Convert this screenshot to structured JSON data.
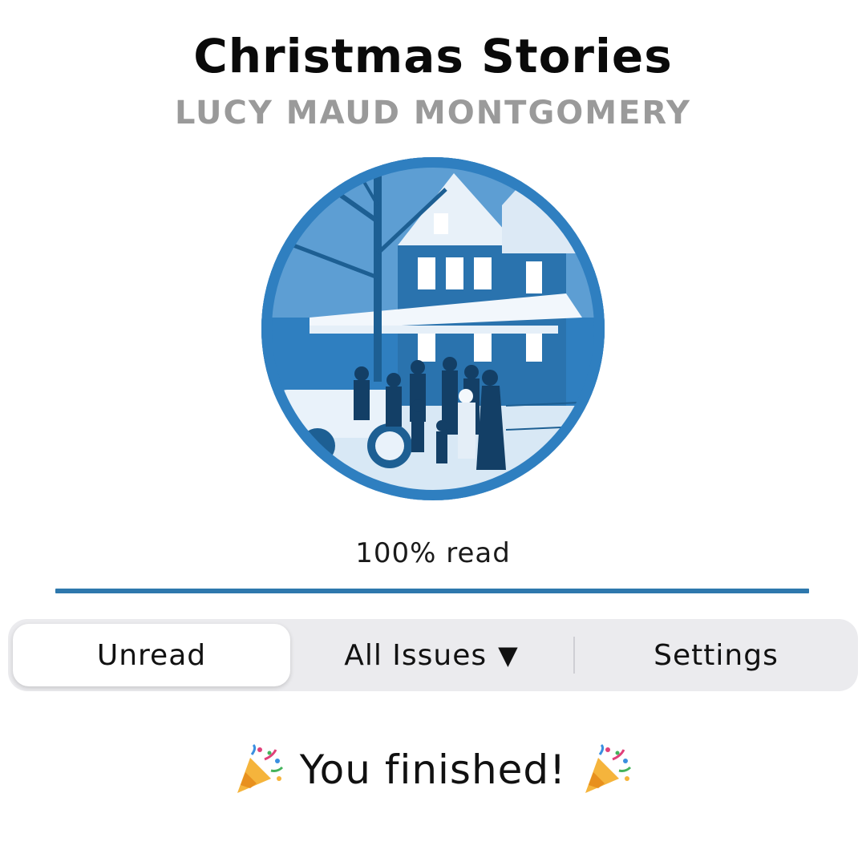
{
  "book": {
    "title": "Christmas Stories",
    "author": "LUCY MAUD MONTGOMERY",
    "cover_icon": "victorian-house-illustration",
    "cover_tint": "#2f7fc0"
  },
  "progress": {
    "label": "100% read",
    "fraction": 1.0,
    "color": "#2e78ad"
  },
  "tabs": {
    "unread_label": "Unread",
    "issues_label": "All Issues",
    "issues_caret": "▼",
    "settings_label": "Settings",
    "selected": "Unread"
  },
  "message": {
    "text": "You finished!",
    "icon": "party-popper-icon"
  }
}
